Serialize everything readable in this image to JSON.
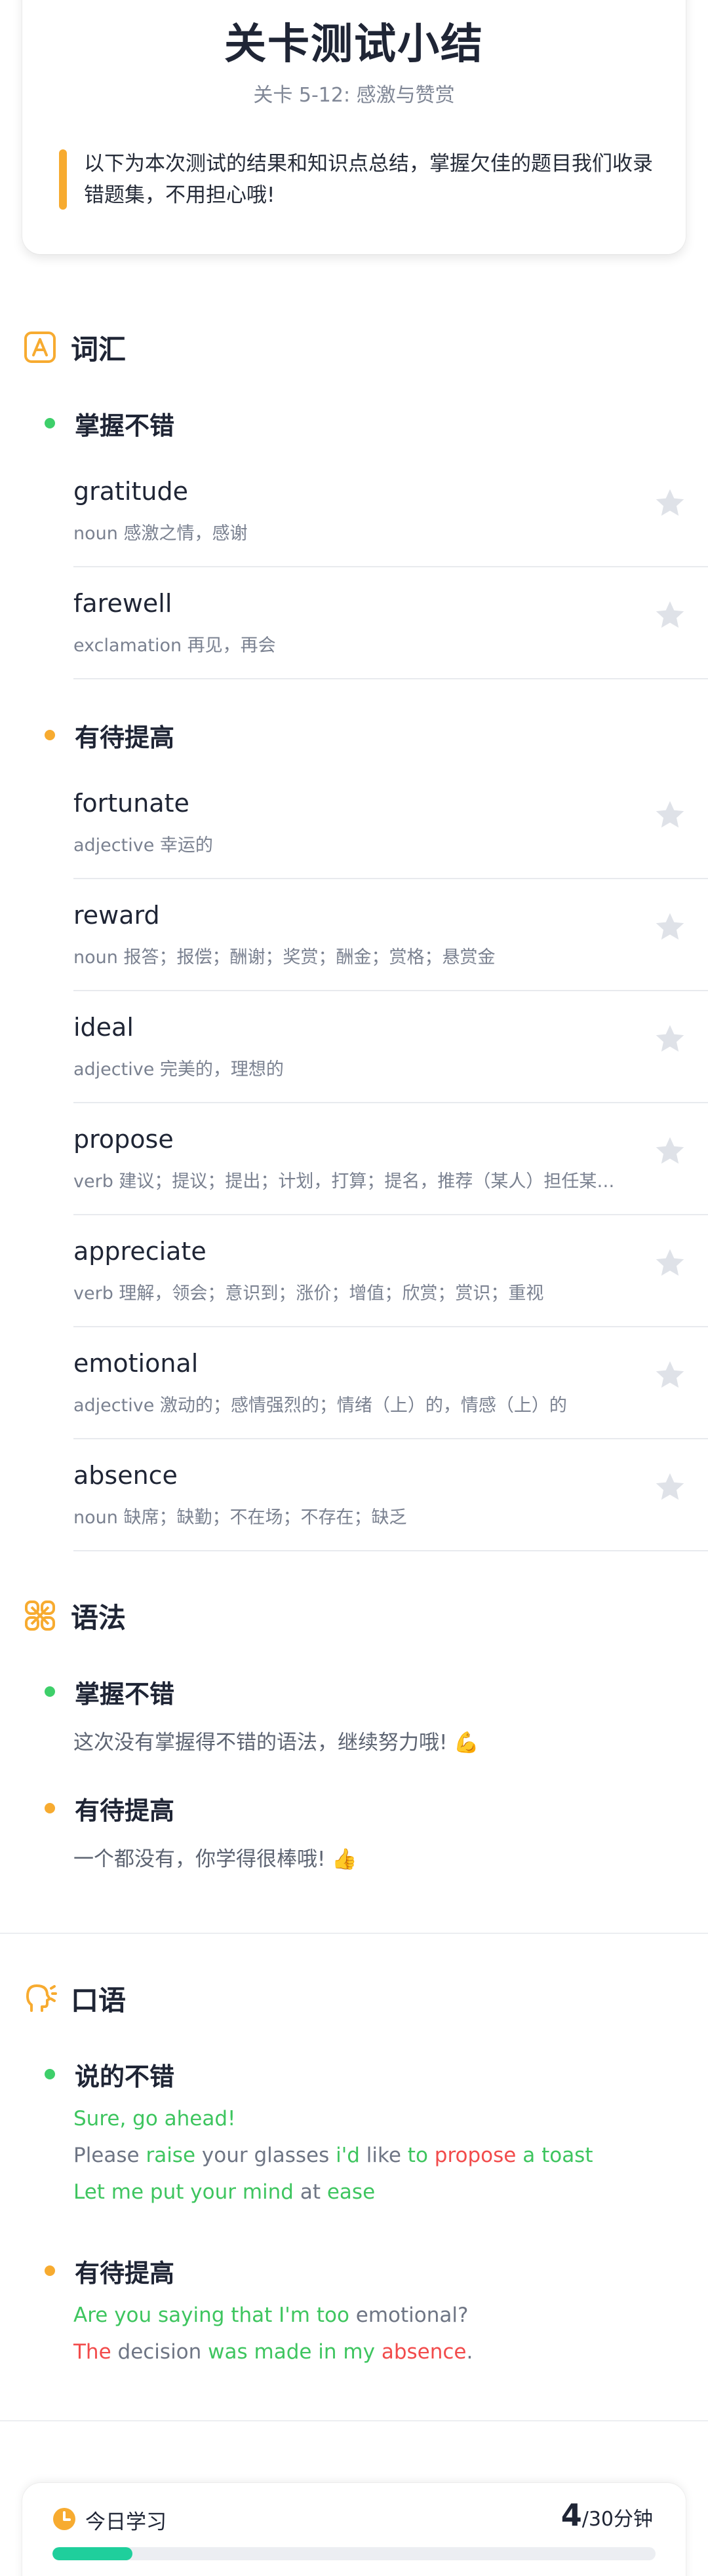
{
  "header": {
    "title": "关卡测试小结",
    "subtitle": "关卡 5-12: 感激与赞赏",
    "intro": "以下为本次测试的结果和知识点总结，掌握欠佳的题目我们收录错题集，不用担心哦!"
  },
  "vocab": {
    "title": "词汇",
    "icon": "letter-a-icon",
    "good_title": "掌握不错",
    "improve_title": "有待提高",
    "good_words": [
      {
        "word": "gratitude",
        "def": "noun 感激之情，感谢"
      },
      {
        "word": "farewell",
        "def": "exclamation 再见，再会"
      }
    ],
    "improve_words": [
      {
        "word": "fortunate",
        "def": "adjective 幸运的"
      },
      {
        "word": "reward",
        "def": "noun 报答；报偿；酬谢；奖赏；酬金；赏格；悬赏金"
      },
      {
        "word": "ideal",
        "def": "adjective 完美的，理想的"
      },
      {
        "word": "propose",
        "def": "verb 建议；提议；提出；计划，打算；提名，推荐（某人）担任某职（或成为某组织成员）"
      },
      {
        "word": "appreciate",
        "def": "verb 理解，领会；意识到；涨价；增值；欣赏；赏识；重视"
      },
      {
        "word": "emotional",
        "def": "adjective 激动的；感情强烈的；情绪（上）的，情感（上）的"
      },
      {
        "word": "absence",
        "def": "noun 缺席；缺勤；不在场；不存在；缺乏"
      }
    ]
  },
  "grammar": {
    "title": "语法",
    "icon": "grammar-knot-icon",
    "good_title": "掌握不错",
    "good_text": "这次没有掌握得不错的语法，继续努力哦! 💪",
    "improve_title": "有待提高",
    "improve_text": "一个都没有，你学得很棒哦! 👍"
  },
  "speaking": {
    "title": "口语",
    "icon": "speaking-head-icon",
    "good_title": "说的不错",
    "improve_title": "有待提高",
    "good_lines": [
      [
        {
          "t": "Sure, go ahead!",
          "c": "green"
        }
      ],
      [
        {
          "t": "Please ",
          "c": "gray"
        },
        {
          "t": "raise ",
          "c": "green"
        },
        {
          "t": "your glasses ",
          "c": "gray"
        },
        {
          "t": "i'd ",
          "c": "green"
        },
        {
          "t": "like ",
          "c": "gray"
        },
        {
          "t": "to ",
          "c": "green"
        },
        {
          "t": "propose ",
          "c": "red"
        },
        {
          "t": "a toast",
          "c": "green"
        }
      ],
      [
        {
          "t": "Let me put your mind ",
          "c": "green"
        },
        {
          "t": "at ",
          "c": "gray"
        },
        {
          "t": "ease",
          "c": "green"
        }
      ]
    ],
    "improve_lines": [
      [
        {
          "t": "Are you saying that I'm too ",
          "c": "green"
        },
        {
          "t": "emotional?",
          "c": "gray"
        }
      ],
      [
        {
          "t": "The ",
          "c": "red"
        },
        {
          "t": "decision ",
          "c": "gray"
        },
        {
          "t": "was made in my ",
          "c": "green"
        },
        {
          "t": "absence",
          "c": "red"
        },
        {
          "t": ".",
          "c": "gray"
        }
      ]
    ]
  },
  "today": {
    "label": "今日学习",
    "icon": "clock-icon",
    "value": "4",
    "unit": "/30分钟",
    "progress": 0.133
  },
  "colors": {
    "accent_orange": "#f7ab30",
    "good_green": "#3ecf6a",
    "text_red": "#f24b4b",
    "progress_teal": "#1fcf9c",
    "star_gray": "#dfe2e8"
  }
}
